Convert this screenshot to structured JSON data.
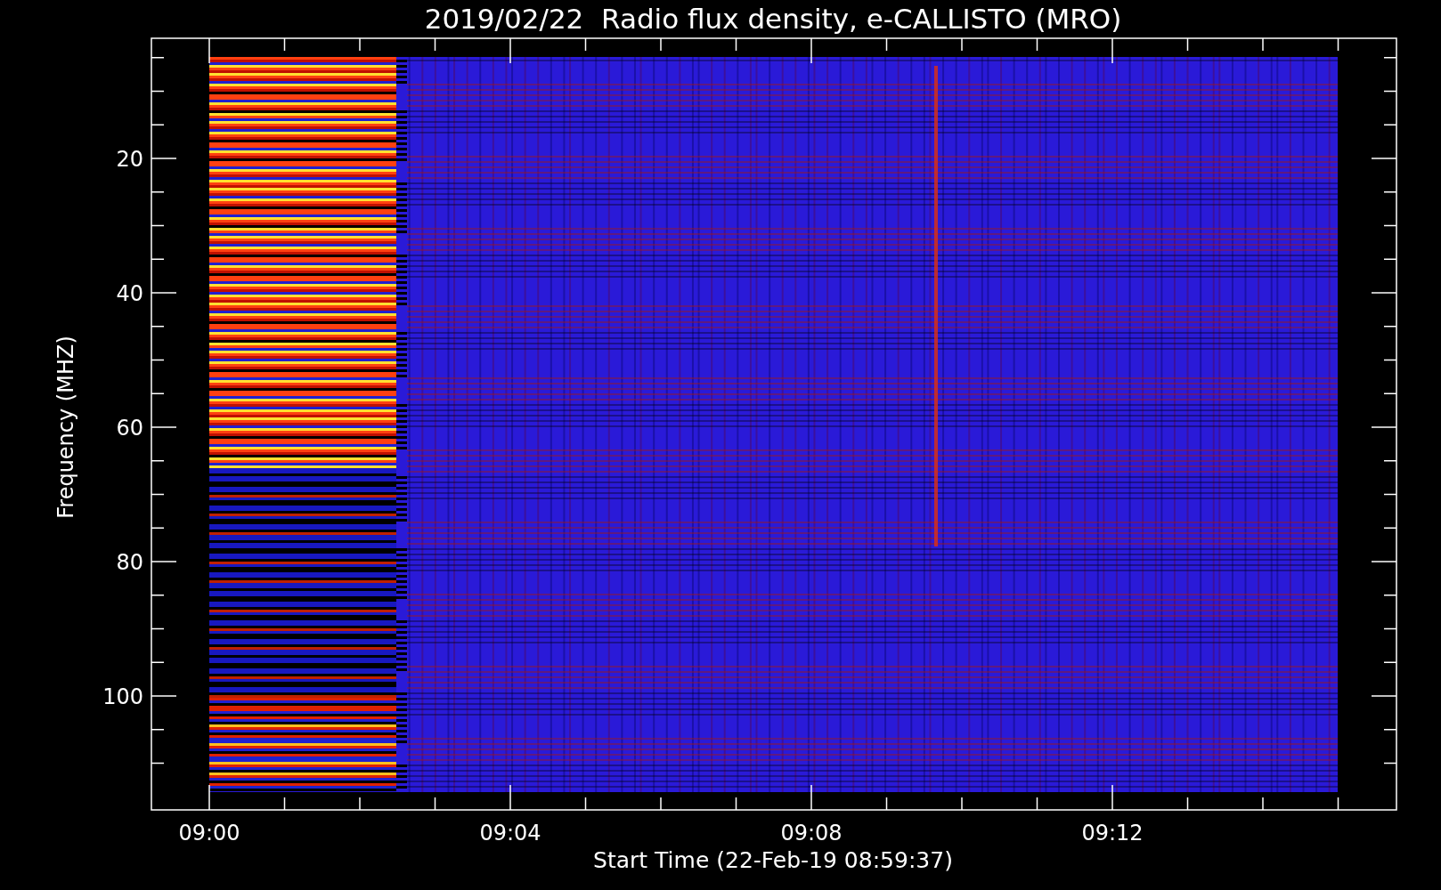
{
  "title": "2019/02/22  Radio flux density, e-CALLISTO (MRO)",
  "y_axis": {
    "label": "Frequency (MHZ)",
    "ticks": [
      "20",
      "40",
      "60",
      "80",
      "100"
    ]
  },
  "x_axis": {
    "label": "Start Time (22-Feb-19 08:59:37)",
    "ticks": [
      "09:00",
      "09:04",
      "09:08",
      "09:12"
    ]
  }
}
